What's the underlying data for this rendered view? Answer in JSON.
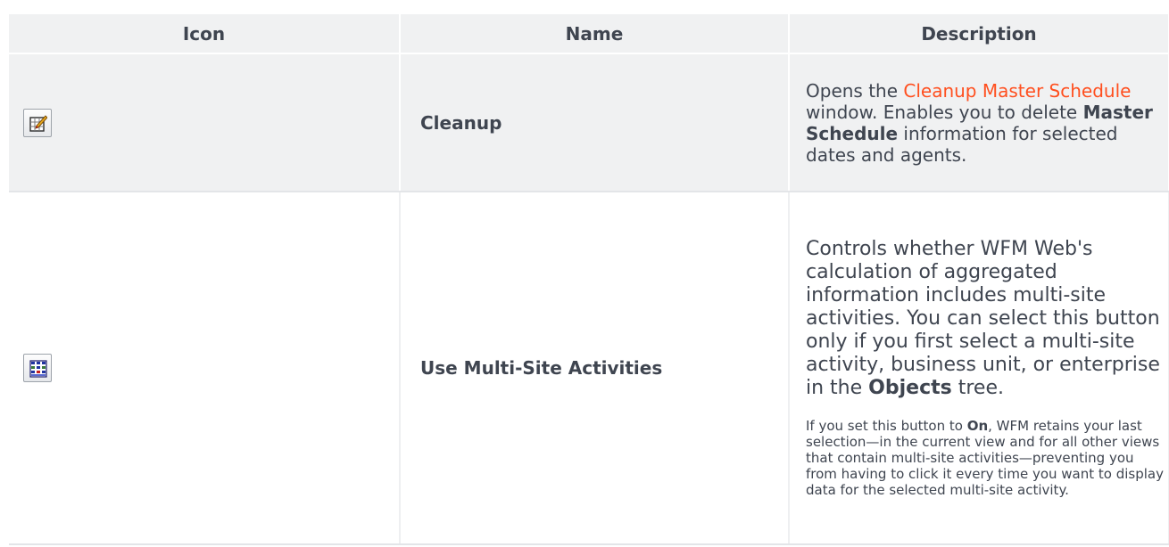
{
  "table": {
    "headers": [
      "Icon",
      "Name",
      "Description"
    ],
    "rows": [
      {
        "icon": "cleanup-icon",
        "name": "Cleanup",
        "description": {
          "pre_link": "Opens the ",
          "link": "Cleanup Master Schedule",
          "post_link": " window. Enables you to delete ",
          "bold": "Master Schedule",
          "tail": " information for selected dates and agents."
        }
      },
      {
        "icon": "multi-site-activities-icon",
        "name": "Use Multi-Site Activities",
        "description": {
          "p1_text": "Controls whether WFM Web's calculation of aggregated information includes multi-site activities. You can select this button only if you first select a multi-site activity, business unit, or enterprise in the ",
          "p1_bold": "Objects",
          "p1_tail": " tree.",
          "p2_pre": "If you set this button to ",
          "p2_bold": "On",
          "p2_tail": ", WFM retains your last selection—in the current view and for all other views that contain multi-site activities—preventing you from having to click it every time you want to display data for the selected multi-site activity."
        }
      }
    ]
  },
  "colors": {
    "header_bg": "#f0f1f2",
    "text": "#3f4550",
    "link": "#ff4f1f"
  }
}
